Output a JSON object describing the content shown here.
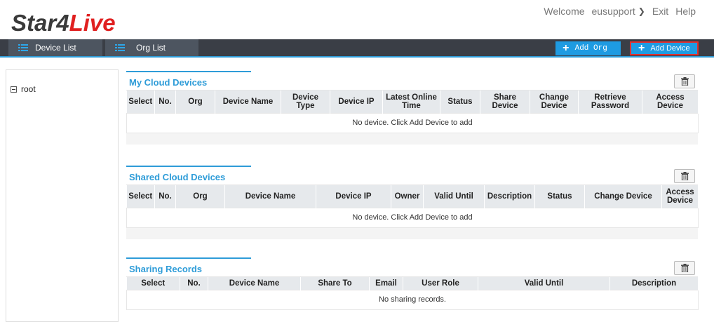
{
  "brand": {
    "part1": "Star4",
    "part2": "Live"
  },
  "toplinks": {
    "welcome": "Welcome",
    "user": "eusupport",
    "exit": "Exit",
    "help": "Help"
  },
  "nav": {
    "tabs": [
      {
        "label": "Device List"
      },
      {
        "label": "Org List"
      }
    ],
    "add_org": "Add Org",
    "add_device": "Add Device"
  },
  "sidebar": {
    "root": "root"
  },
  "my_cloud": {
    "title": "My Cloud Devices",
    "columns": [
      "Select",
      "No.",
      "Org",
      "Device Name",
      "Device Type",
      "Device IP",
      "Latest Online Time",
      "Status",
      "Share Device",
      "Change Device",
      "Retrieve Password",
      "Access Device"
    ],
    "empty": "No device. Click Add Device to add"
  },
  "shared_cloud": {
    "title": "Shared Cloud Devices",
    "columns": [
      "Select",
      "No.",
      "Org",
      "Device Name",
      "Device IP",
      "Owner",
      "Valid Until",
      "Description",
      "Status",
      "Change Device",
      "Access Device"
    ],
    "empty": "No device. Click Add Device to add"
  },
  "sharing_records": {
    "title": "Sharing Records",
    "columns": [
      "Select",
      "No.",
      "Device Name",
      "Share To",
      "Email",
      "User Role",
      "Valid Until",
      "Description"
    ],
    "empty": "No sharing records."
  },
  "icons": {
    "list": "list-icon",
    "plus": "plus-icon",
    "trash": "trash-icon",
    "chevron": "chevron-down-icon",
    "tree_collapse": "collapse-box-icon"
  },
  "colors": {
    "accent": "#2e9cd8",
    "navbar": "#3a3e46",
    "button": "#1e9be2",
    "brand_red": "#e02020",
    "highlight": "#e03030"
  }
}
